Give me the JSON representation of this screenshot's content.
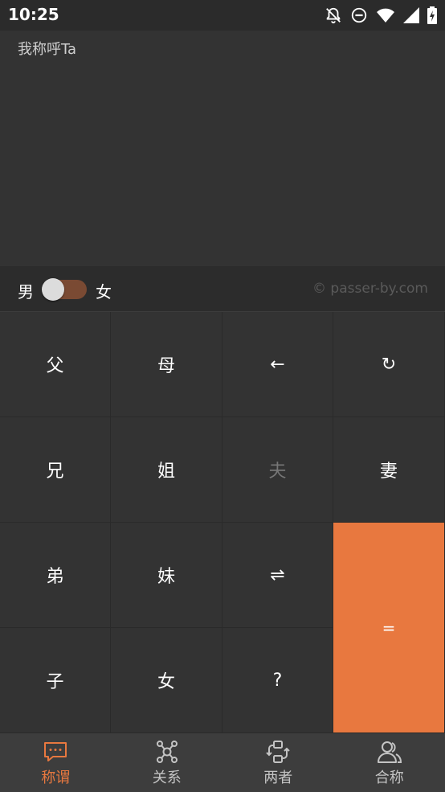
{
  "status_bar": {
    "time": "10:25",
    "icons": [
      "bell-off-icon",
      "dnd-icon",
      "wifi-icon",
      "signal-icon",
      "battery-charging-icon"
    ]
  },
  "display": {
    "text": "我称呼Ta"
  },
  "gender_bar": {
    "male_label": "男",
    "female_label": "女",
    "watermark": "© passer-by.com",
    "toggle_state": "male"
  },
  "keypad": {
    "keys": [
      {
        "label": "父",
        "name": "key-father"
      },
      {
        "label": "母",
        "name": "key-mother"
      },
      {
        "label": "←",
        "name": "key-backspace"
      },
      {
        "label": "↻",
        "name": "key-reset"
      },
      {
        "label": "兄",
        "name": "key-elder-brother"
      },
      {
        "label": "姐",
        "name": "key-elder-sister"
      },
      {
        "label": "夫",
        "name": "key-husband"
      },
      {
        "label": "妻",
        "name": "key-wife"
      },
      {
        "label": "弟",
        "name": "key-younger-brother"
      },
      {
        "label": "妹",
        "name": "key-younger-sister"
      },
      {
        "label": "⇌",
        "name": "key-swap"
      },
      {
        "label": "子",
        "name": "key-son"
      },
      {
        "label": "女",
        "name": "key-daughter"
      },
      {
        "label": "?",
        "name": "key-question"
      },
      {
        "label": "=",
        "name": "key-equals"
      }
    ]
  },
  "bottom_nav": {
    "items": [
      {
        "label": "称谓",
        "icon": "chat-icon",
        "active": true
      },
      {
        "label": "关系",
        "icon": "network-icon",
        "active": false
      },
      {
        "label": "两者",
        "icon": "swap-icon",
        "active": false
      },
      {
        "label": "合称",
        "icon": "users-icon",
        "active": false
      }
    ]
  },
  "colors": {
    "accent": "#e8783f",
    "background": "#333333",
    "toggle_track": "#7a4a33"
  }
}
